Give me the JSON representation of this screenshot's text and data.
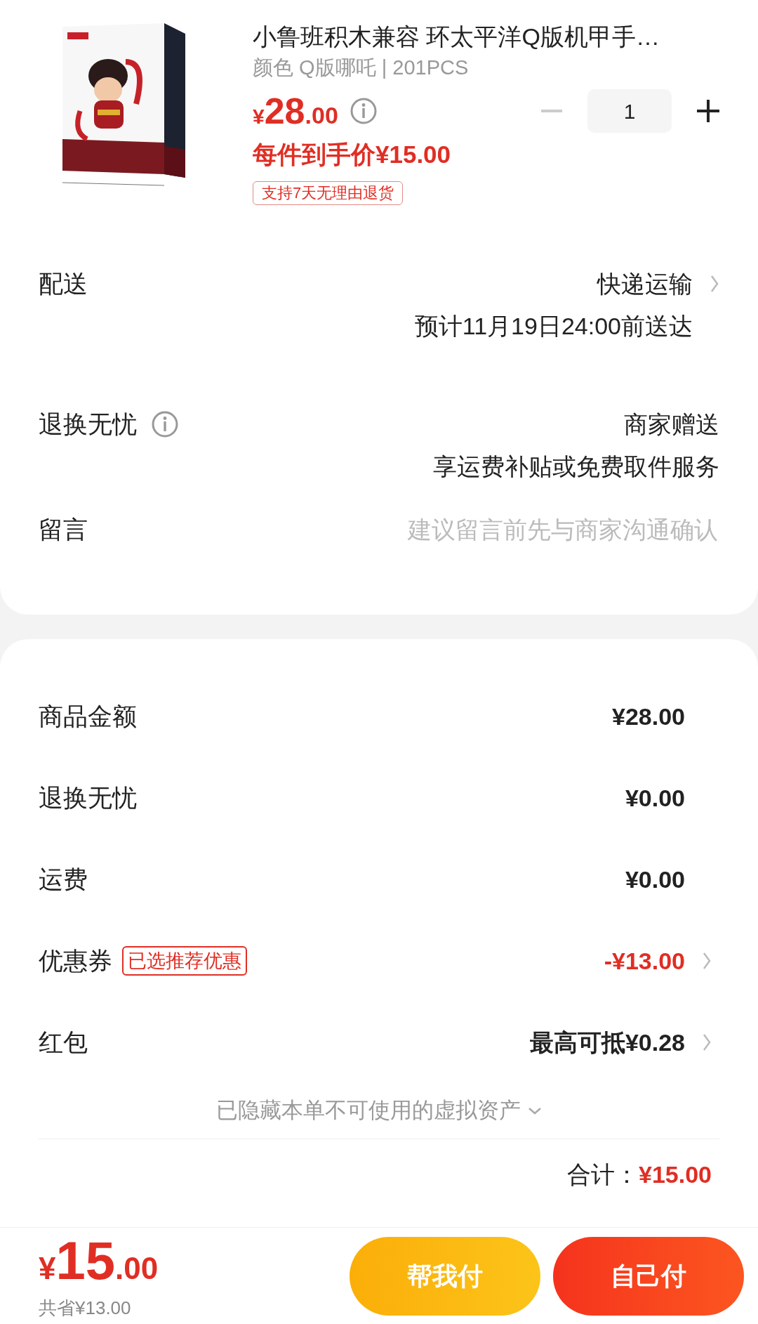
{
  "product": {
    "title": "小鲁班积木兼容 环太平洋Q版机甲手…",
    "spec": "颜色 Q版哪吒 | 201PCS",
    "price_symbol": "¥",
    "price_int": "28",
    "price_dec": ".00",
    "quantity": "1",
    "minus_disabled": true,
    "final_price": "每件到手价¥15.00",
    "tag": "支持7天无理由退货"
  },
  "options": [
    {
      "kind": "info",
      "label": "配送",
      "info_icon": false,
      "chevron": true,
      "lines": [
        "快递运输",
        "预计11月19日24:00前送达"
      ]
    },
    {
      "kind": "info",
      "label": "退换无忧",
      "info_icon": true,
      "chevron": false,
      "lines": [
        "商家赠送",
        "享运费补贴或免费取件服务"
      ]
    },
    {
      "kind": "input",
      "label": "留言",
      "placeholder": "建议留言前先与商家沟通确认"
    }
  ],
  "summary": [
    {
      "label": "商品金额",
      "value": "¥28.00",
      "highlight": false,
      "chevron": false
    },
    {
      "label": "退换无忧",
      "value": "¥0.00",
      "highlight": false,
      "chevron": false
    },
    {
      "label": "运费",
      "value": "¥0.00",
      "highlight": false,
      "chevron": false
    },
    {
      "label": "优惠券",
      "tag": "已选推荐优惠",
      "value": "-¥13.00",
      "highlight": true,
      "chevron": true
    },
    {
      "label": "红包",
      "value": "最高可抵¥0.28",
      "highlight": false,
      "chevron": true
    }
  ],
  "hidden_note": "已隐藏本单不可使用的虚拟资产",
  "total": {
    "label": "合计：",
    "value": "¥15.00"
  },
  "bottom_bar": {
    "currency": "¥",
    "amount_int": "15",
    "amount_dec": ".00",
    "saved": "共省¥13.00",
    "buttons": [
      {
        "label": "帮我付",
        "kind": "friend"
      },
      {
        "label": "自己付",
        "kind": "self"
      }
    ]
  }
}
